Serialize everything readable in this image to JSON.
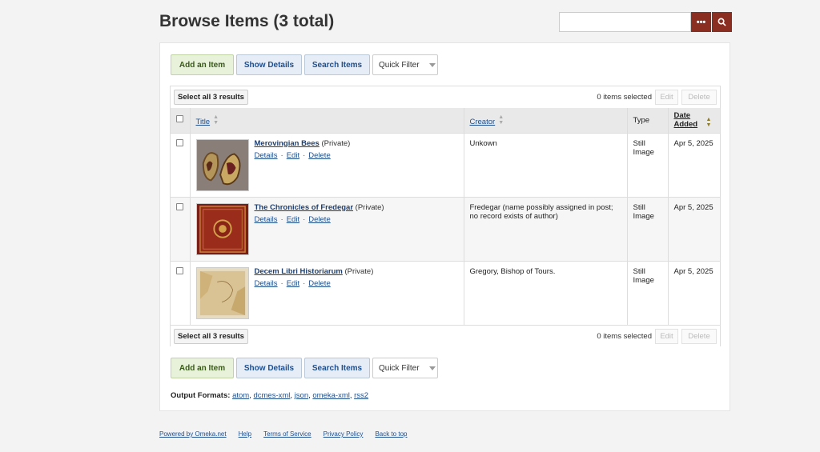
{
  "page": {
    "title": "Browse Items (3 total)"
  },
  "search": {
    "placeholder": "",
    "options_icon": "ellipsis-icon",
    "submit_icon": "search-icon"
  },
  "actions": {
    "add_item": "Add an Item",
    "show_details": "Show Details",
    "search_items": "Search Items",
    "quick_filter": "Quick Filter"
  },
  "selection": {
    "select_all": "Select all 3 results",
    "count": "0 items selected",
    "edit": "Edit",
    "delete": "Delete"
  },
  "table": {
    "headers": {
      "title": "Title",
      "creator": "Creator",
      "type": "Type",
      "date_added": "Date Added"
    },
    "rows": [
      {
        "title": "Merovingian Bees",
        "visibility": "(Private)",
        "creator": "Unkown",
        "type": "Still Image",
        "date_added": "Apr 5, 2025",
        "links": {
          "details": "Details",
          "edit": "Edit",
          "delete": "Delete"
        }
      },
      {
        "title": "The Chronicles of Fredegar",
        "visibility": "(Private)",
        "creator": "Fredegar (name possibly assigned in post; no record exists of author)",
        "type": "Still Image",
        "date_added": "Apr 5, 2025",
        "links": {
          "details": "Details",
          "edit": "Edit",
          "delete": "Delete"
        }
      },
      {
        "title": "Decem Libri Historiarum",
        "visibility": "(Private)",
        "creator": "Gregory, Bishop of Tours.",
        "type": "Still Image",
        "date_added": "Apr 5, 2025",
        "links": {
          "details": "Details",
          "edit": "Edit",
          "delete": "Delete"
        }
      }
    ]
  },
  "output_formats": {
    "label": "Output Formats:",
    "formats": [
      "atom",
      "dcmes-xml",
      "json",
      "omeka-xml",
      "rss2"
    ]
  },
  "footer": {
    "links": [
      "Powered by Omeka.net",
      "Help",
      "Terms of Service",
      "Privacy Policy",
      "Back to top"
    ]
  },
  "colors": {
    "accent": "#8b2e22",
    "link": "#1f4f8f",
    "add_button_bg": "#e8f2db",
    "blue_button_bg": "#e6edf6"
  }
}
